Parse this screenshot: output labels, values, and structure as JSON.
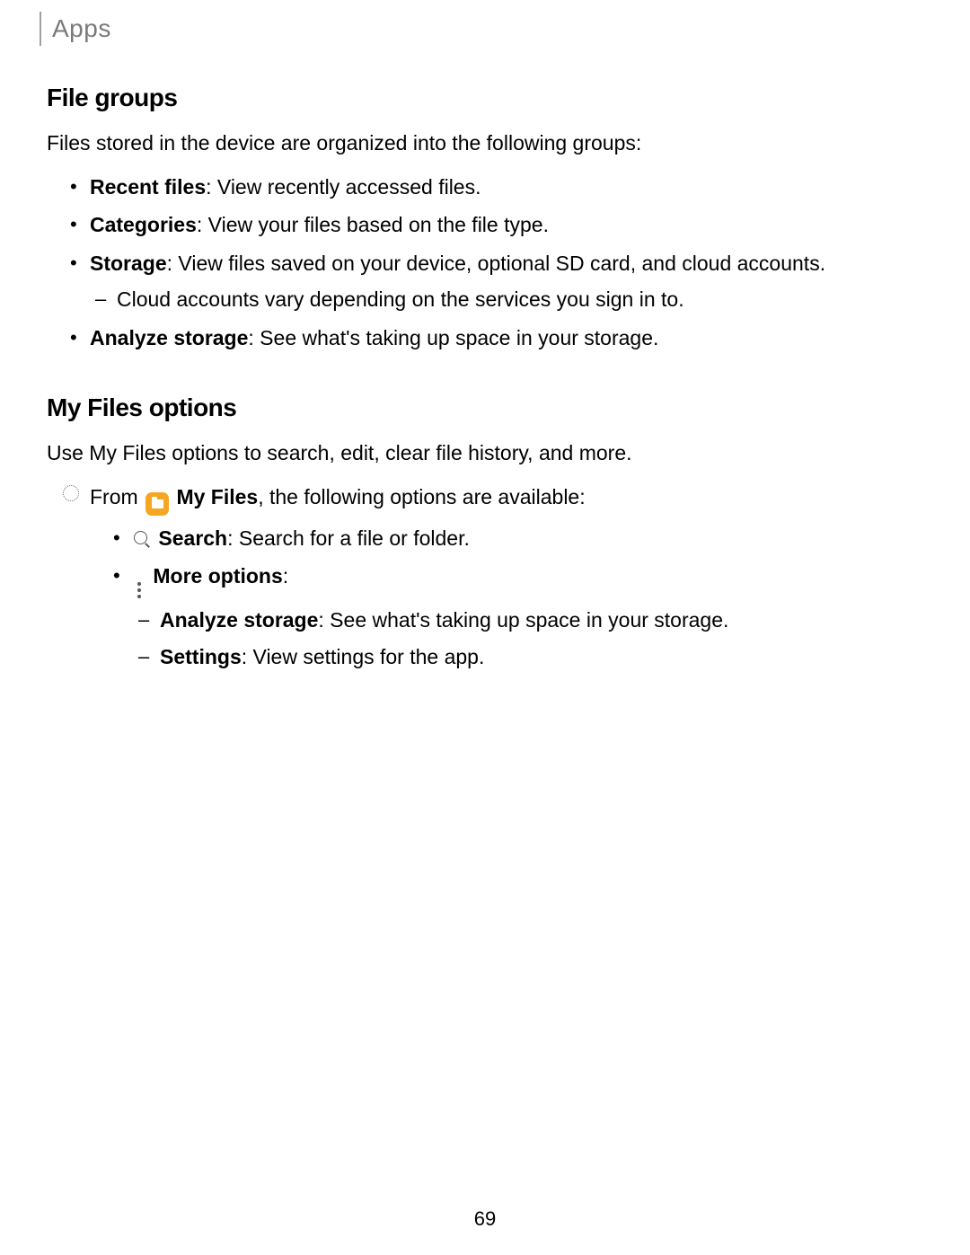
{
  "header": {
    "section": "Apps"
  },
  "file_groups": {
    "title": "File groups",
    "intro": "Files stored in the device are organized into the following groups:",
    "items": [
      {
        "label": "Recent files",
        "desc": ": View recently accessed files."
      },
      {
        "label": "Categories",
        "desc": ": View your files based on the file type."
      },
      {
        "label": "Storage",
        "desc": ": View files saved on your device, optional SD card, and cloud accounts.",
        "sub": [
          "Cloud accounts vary depending on the services you sign in to."
        ]
      },
      {
        "label": "Analyze storage",
        "desc": ": See what's taking up space in your storage."
      }
    ]
  },
  "my_files": {
    "title": "My Files options",
    "intro": "Use My Files options to search, edit, clear file history, and more.",
    "from_prefix": "From ",
    "from_app": "My Files",
    "from_suffix": ", the following options are available:",
    "options": [
      {
        "icon": "search",
        "label": "Search",
        "desc": ": Search for a file or folder."
      },
      {
        "icon": "more",
        "label": "More options",
        "desc": ":",
        "sub": [
          {
            "label": "Analyze storage",
            "desc": ": See what's taking up space in your storage."
          },
          {
            "label": "Settings",
            "desc": ": View settings for the app."
          }
        ]
      }
    ]
  },
  "page_number": "69"
}
